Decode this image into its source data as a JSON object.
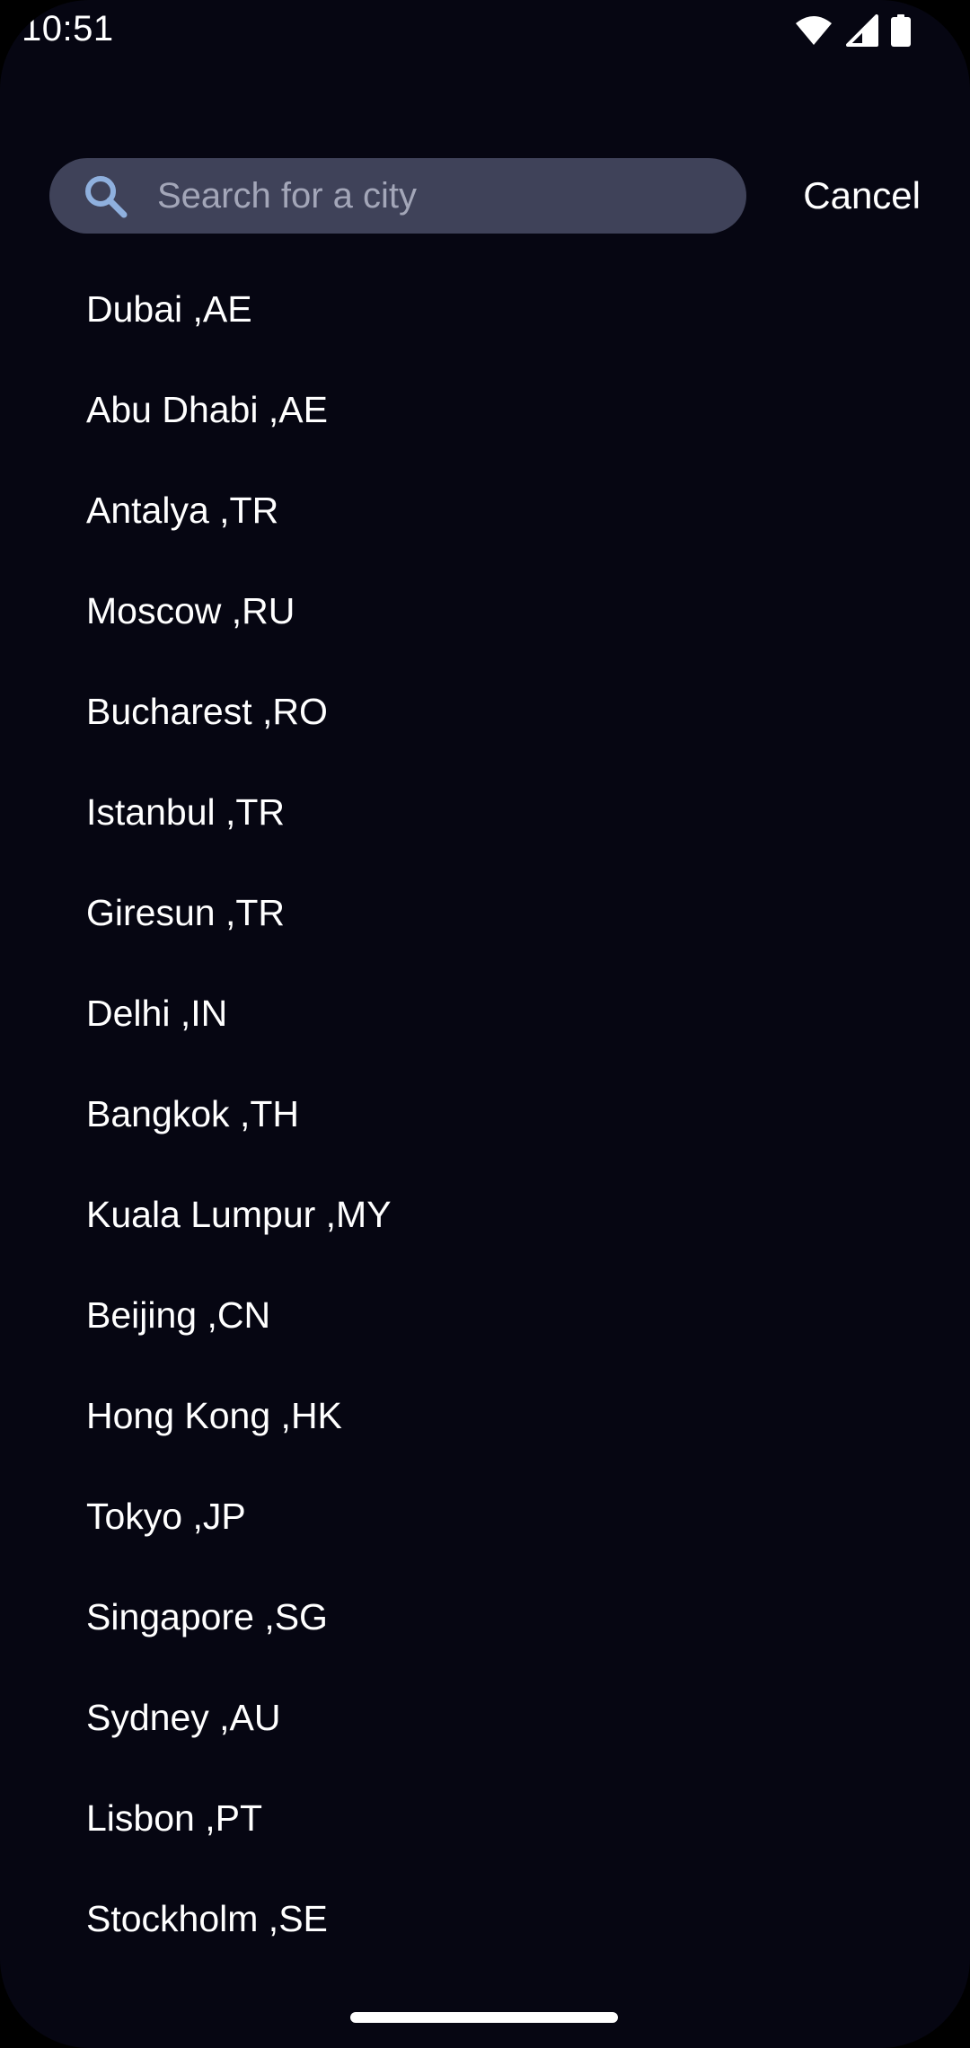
{
  "status_bar": {
    "time": "10:51",
    "icons": [
      "wifi-icon",
      "cellular-signal-icon",
      "battery-icon"
    ]
  },
  "search": {
    "placeholder": "Search for a city",
    "value": "",
    "icon": "search-icon",
    "cancel_label": "Cancel"
  },
  "cities": [
    {
      "label": "Dubai ,AE"
    },
    {
      "label": "Abu Dhabi ,AE"
    },
    {
      "label": "Antalya ,TR"
    },
    {
      "label": "Moscow ,RU"
    },
    {
      "label": "Bucharest ,RO"
    },
    {
      "label": "Istanbul ,TR"
    },
    {
      "label": "Giresun ,TR"
    },
    {
      "label": "Delhi ,IN"
    },
    {
      "label": "Bangkok ,TH"
    },
    {
      "label": "Kuala Lumpur ,MY"
    },
    {
      "label": "Beijing ,CN"
    },
    {
      "label": "Hong Kong ,HK"
    },
    {
      "label": "Tokyo ,JP"
    },
    {
      "label": "Singapore ,SG"
    },
    {
      "label": "Sydney ,AU"
    },
    {
      "label": "Lisbon ,PT"
    },
    {
      "label": "Stockholm ,SE"
    }
  ],
  "colors": {
    "background": "#060612",
    "search_field": "#3f4259",
    "search_icon": "#8fb0de",
    "placeholder": "#a3a6b8",
    "text": "#ffffff"
  }
}
